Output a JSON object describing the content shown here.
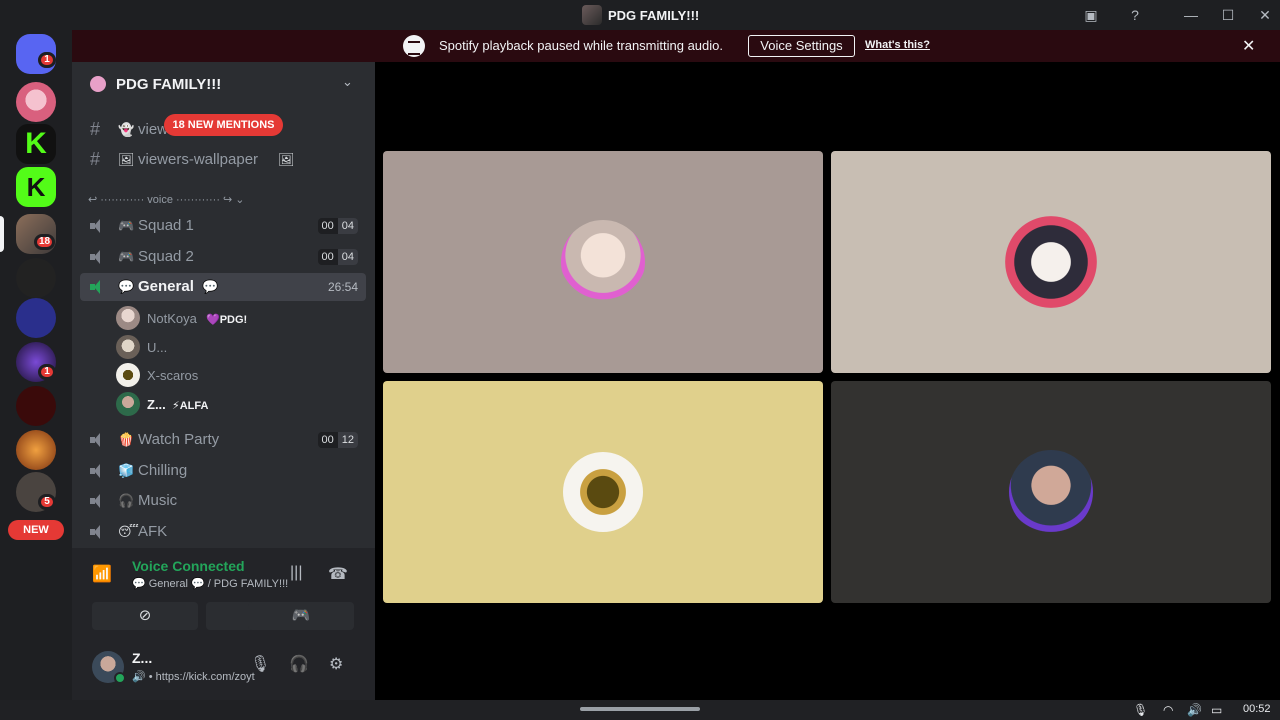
{
  "window": {
    "title": "PDG FAMILY!!!"
  },
  "rail": {
    "home_badge": "1",
    "server_badges": [
      "18",
      "1",
      "5"
    ],
    "new_label": "NEW"
  },
  "notice": {
    "text": "Spotify playback paused while transmitting audio.",
    "button": "Voice Settings",
    "link": "What's this?"
  },
  "guild": {
    "name": "PDG FAMILY!!!"
  },
  "text_channels": [
    {
      "emoji": "👻",
      "name": "view"
    },
    {
      "emoji": "🖼",
      "name": "viewers-wallpaper",
      "suffix": "🖼"
    }
  ],
  "mentions_pill": "18 NEW MENTIONS",
  "category": "↩ ············ voice ············ ↪ ⌄",
  "voice_channels": [
    {
      "emoji": "🎮",
      "name": "Squad 1",
      "limit": [
        "00",
        "04"
      ]
    },
    {
      "emoji": "🎮",
      "name": "Squad 2",
      "limit": [
        "00",
        "04"
      ]
    },
    {
      "emoji": "💬",
      "name": "General",
      "suffix": "💬",
      "timer": "26:54"
    },
    {
      "emoji": "🍿",
      "name": "Watch Party",
      "limit": [
        "00",
        "12"
      ]
    },
    {
      "emoji": "🧊",
      "name": "Chilling"
    },
    {
      "emoji": "🎧",
      "name": "Music"
    },
    {
      "emoji": "😴",
      "name": "AFK"
    }
  ],
  "voice_users": [
    {
      "name": "NotKoya",
      "tag": "💜PDG!"
    },
    {
      "name": "U..."
    },
    {
      "name": "X-scaros"
    },
    {
      "name": "Z...",
      "tag": "⚡ALFA"
    }
  ],
  "voice_panel": {
    "title": "Voice Connected",
    "channel": "💬 General 💬 / PDG FAMILY!!!"
  },
  "user_panel": {
    "name": "Z...",
    "status": "🔊 • https://kick.com/zoyt"
  },
  "tiles": [
    {
      "bg": "#a89a95"
    },
    {
      "bg": "#c8beb3"
    },
    {
      "bg": "#e0d08c"
    },
    {
      "bg": "#333230"
    }
  ],
  "taskbar": {
    "time": "00:52"
  },
  "colors": {
    "accent_green": "#23a55a",
    "badge_red": "#e53935",
    "notice_bg": "#2a0a10"
  }
}
